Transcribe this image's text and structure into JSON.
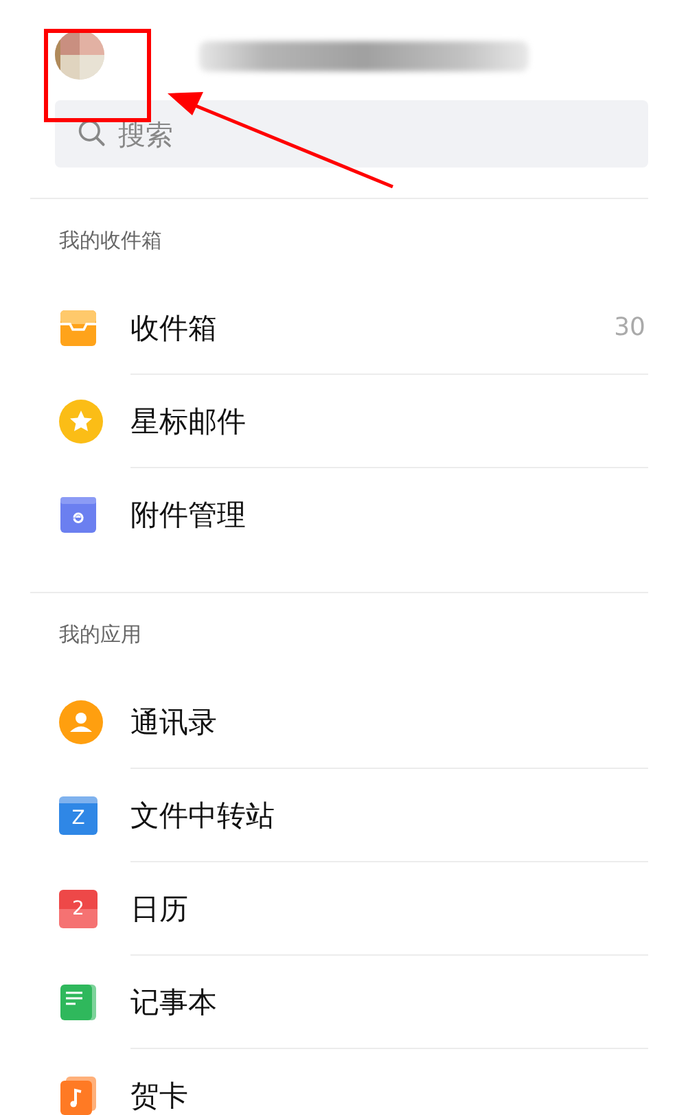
{
  "search": {
    "placeholder": "搜索"
  },
  "sections": [
    {
      "title": "我的收件箱",
      "items": [
        {
          "kind": "inbox",
          "label": "收件箱",
          "count": "30"
        },
        {
          "kind": "star",
          "label": "星标邮件"
        },
        {
          "kind": "attachment",
          "label": "附件管理"
        }
      ]
    },
    {
      "title": "我的应用",
      "items": [
        {
          "kind": "contacts",
          "label": "通讯录"
        },
        {
          "kind": "folder",
          "label": "文件中转站",
          "badge": "Z"
        },
        {
          "kind": "calendar",
          "label": "日历",
          "badge": "2"
        },
        {
          "kind": "notes",
          "label": "记事本"
        },
        {
          "kind": "card",
          "label": "贺卡"
        }
      ]
    }
  ]
}
